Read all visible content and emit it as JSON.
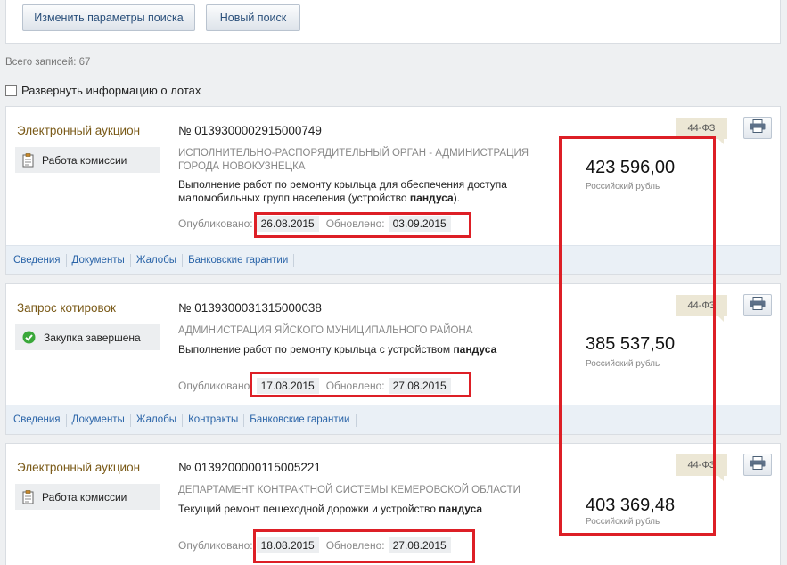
{
  "toolbar": {
    "change_params_label": "Изменить параметры поиска",
    "new_search_label": "Новый поиск"
  },
  "summary": {
    "total_label": "Всего записей: 67",
    "expand_label": "Развернуть информацию о лотах",
    "expand_checked": false
  },
  "records": [
    {
      "procedure_type": "Электронный аукцион",
      "status": "Работа комиссии",
      "status_icon": "clipboard-icon",
      "number": "№ 0139300002915000749",
      "organization": "ИСПОЛНИТЕЛЬНО-РАСПОРЯДИТЕЛЬНЫЙ ОРГАН - АДМИНИСТРАЦИЯ ГОРОДА НОВОКУЗНЕЦКА",
      "description_pre": "Выполнение работ по ремонту крыльца для обеспечения доступа маломобильных групп населения (устройство ",
      "description_bold": "пандуса",
      "description_post": ").",
      "published_label": "Опубликовано:",
      "published": "26.08.2015",
      "updated_label": "Обновлено:",
      "updated": "03.09.2015",
      "price": "423 596,00",
      "currency": "Российский рубль",
      "law": "44-ФЗ",
      "tabs": [
        "Сведения",
        "Документы",
        "Жалобы",
        "Банковские гарантии"
      ]
    },
    {
      "procedure_type": "Запрос котировок",
      "status": "Закупка завершена",
      "status_icon": "check-circle-icon",
      "number": "№ 0139300031315000038",
      "organization": "АДМИНИСТРАЦИЯ ЯЙСКОГО МУНИЦИПАЛЬНОГО РАЙОНА",
      "description_pre": "Выполнение работ по ремонту крыльца с устройством ",
      "description_bold": "пандуса",
      "description_post": "",
      "published_label": "Опубликовано:",
      "published": "17.08.2015",
      "updated_label": "Обновлено:",
      "updated": "27.08.2015",
      "price": "385 537,50",
      "currency": "Российский рубль",
      "law": "44-ФЗ",
      "tabs": [
        "Сведения",
        "Документы",
        "Жалобы",
        "Контракты",
        "Банковские гарантии"
      ]
    },
    {
      "procedure_type": "Электронный аукцион",
      "status": "Работа комиссии",
      "status_icon": "clipboard-icon",
      "number": "№ 0139200000115005221",
      "organization": "ДЕПАРТАМЕНТ КОНТРАКТНОЙ СИСТЕМЫ КЕМЕРОВСКОЙ ОБЛАСТИ",
      "description_pre": "Текущий ремонт пешеходной дорожки и устройство ",
      "description_bold": "пандуса",
      "description_post": "",
      "published_label": "Опубликовано:",
      "published": "18.08.2015",
      "updated_label": "Обновлено:",
      "updated": "27.08.2015",
      "price": "403 369,48",
      "currency": "Российский рубль",
      "law": "44-ФЗ",
      "tabs": []
    }
  ],
  "colors": {
    "highlight": "#dd1f26",
    "link": "#2a64a8",
    "procedure_type": "#7a5a18"
  }
}
